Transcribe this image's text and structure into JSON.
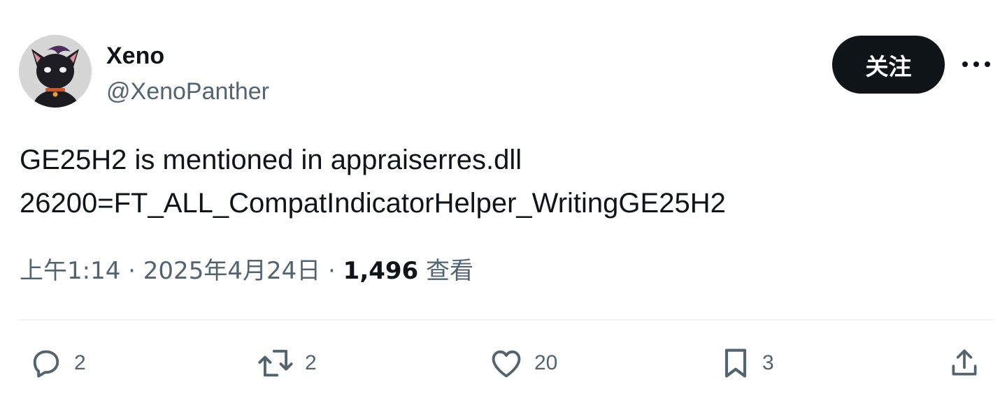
{
  "user": {
    "display_name": "Xeno",
    "handle": "@XenoPanther",
    "avatar_icon": "black-cat-avatar"
  },
  "follow_label": "关注",
  "more_icon": "more-horizontal-icon",
  "tweet": {
    "lines": [
      "GE25H2 is mentioned in appraiserres.dll",
      "26200=FT_ALL_CompatIndicatorHelper_WritingGE25H2"
    ]
  },
  "meta": {
    "time": "上午1:14",
    "separator": "·",
    "date": "2025年4月24日",
    "views_count": "1,496",
    "views_label": "查看"
  },
  "actions": {
    "replies": "2",
    "reposts": "2",
    "likes": "20",
    "bookmarks": "3"
  },
  "colors": {
    "text_primary": "#0f1419",
    "text_secondary": "#536471",
    "button_bg": "#0f1419",
    "divider": "#eff3f4"
  }
}
